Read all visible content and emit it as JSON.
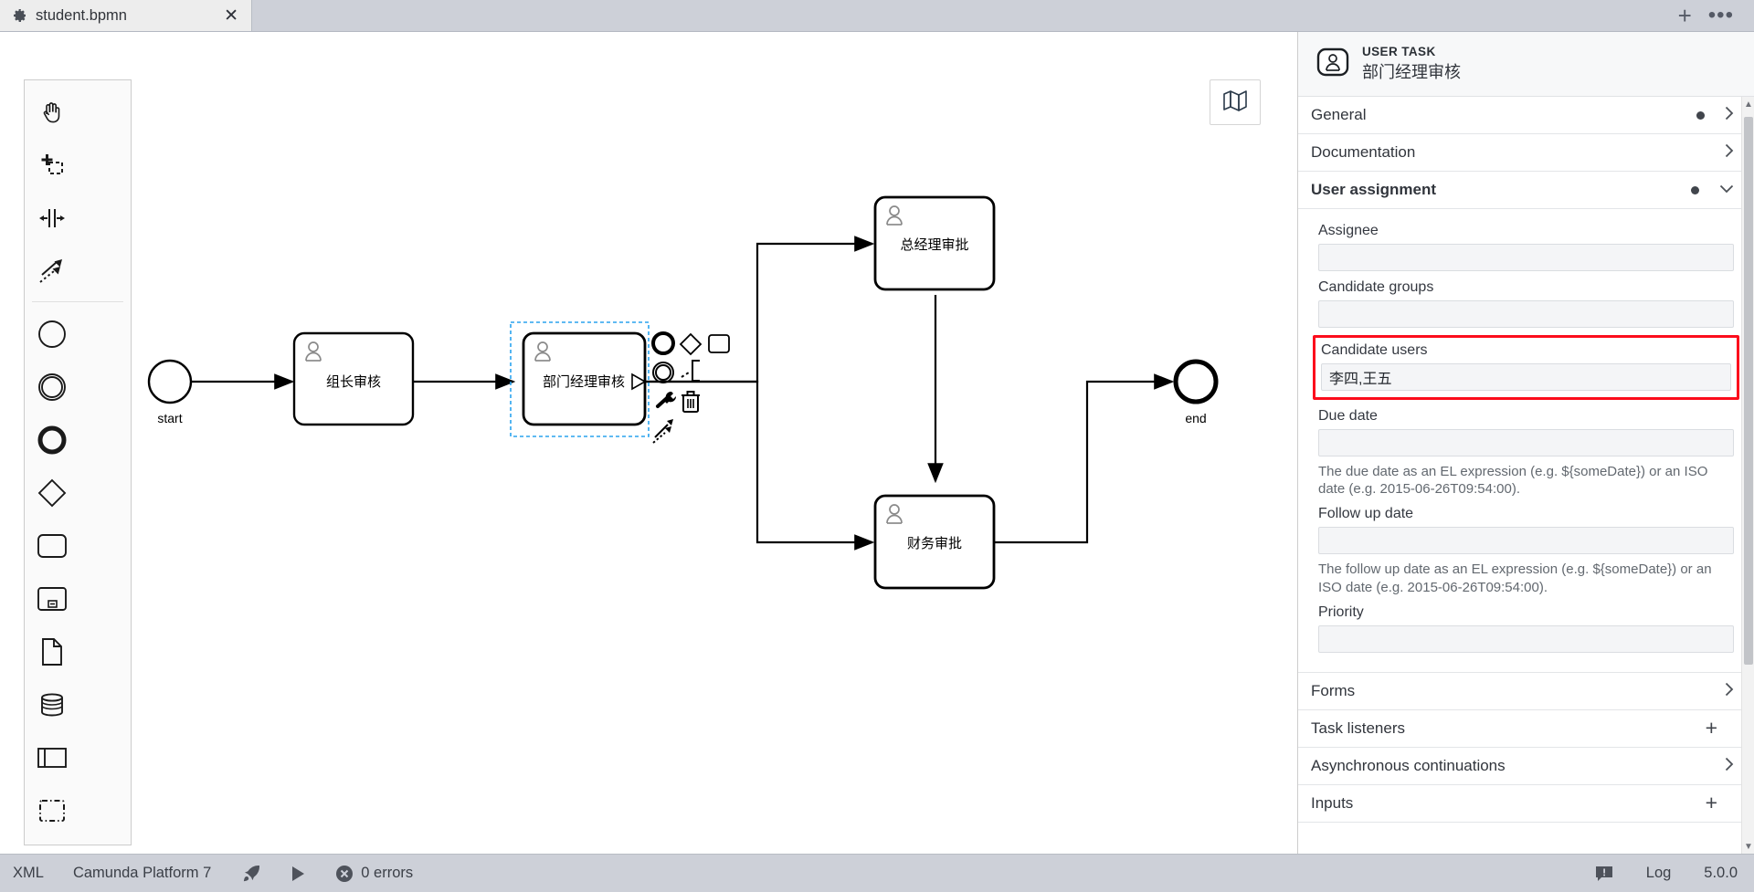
{
  "tabbar": {
    "tab_title": "student.bpmn",
    "tab_icon": "gear-icon",
    "close_label": "✕",
    "add_label": "+",
    "more_label": "•••"
  },
  "palette": {
    "tools": [
      {
        "name": "hand-tool",
        "label": "Activate the hand tool"
      },
      {
        "name": "lasso-tool",
        "label": "Activate the lasso tool"
      },
      {
        "name": "space-tool",
        "label": "Activate the create/remove space tool"
      },
      {
        "name": "connect-tool",
        "label": "Activate the global connect tool"
      },
      {
        "name": "start-event",
        "label": "Create StartEvent"
      },
      {
        "name": "intermediate-event",
        "label": "Create Intermediate/Boundary Event"
      },
      {
        "name": "end-event",
        "label": "Create EndEvent"
      },
      {
        "name": "gateway",
        "label": "Create Gateway"
      },
      {
        "name": "task",
        "label": "Create Task"
      },
      {
        "name": "subprocess-expanded",
        "label": "Create expanded SubProcess"
      },
      {
        "name": "data-object",
        "label": "Create DataObjectReference"
      },
      {
        "name": "data-store",
        "label": "Create DataStoreReference"
      },
      {
        "name": "participant",
        "label": "Create Pool/Participant"
      },
      {
        "name": "group",
        "label": "Create Group"
      }
    ],
    "minimap_label": "map-icon"
  },
  "diagram": {
    "start_event": {
      "label": "start"
    },
    "end_event": {
      "label": "end"
    },
    "tasks": [
      {
        "id": "task1",
        "label": "组长审核",
        "type": "user-task"
      },
      {
        "id": "task2",
        "label": "部门经理审核",
        "type": "user-task",
        "selected": true
      },
      {
        "id": "task3",
        "label": "总经理审批",
        "type": "user-task"
      },
      {
        "id": "task4",
        "label": "财务审批",
        "type": "user-task"
      }
    ],
    "context_pad": [
      {
        "name": "append-end-event-icon"
      },
      {
        "name": "append-gateway-icon"
      },
      {
        "name": "append-task-icon"
      },
      {
        "name": "append-intermediate-event-icon"
      },
      {
        "name": "append-text-annotation-icon"
      },
      {
        "name": "change-type-wrench-icon"
      },
      {
        "name": "delete-trash-icon"
      },
      {
        "name": "connect-arrow-icon"
      }
    ],
    "selection_color": "#2aa3ee"
  },
  "properties": {
    "header": {
      "type": "USER TASK",
      "name": "部门经理审核",
      "icon": "user-task-icon"
    },
    "groups": [
      {
        "id": "general",
        "title": "General",
        "dot": true,
        "control": "chevron-right-icon"
      },
      {
        "id": "documentation",
        "title": "Documentation",
        "dot": false,
        "control": "chevron-right-icon"
      },
      {
        "id": "user_assignment",
        "title": "User assignment",
        "dot": true,
        "control": "chevron-down-icon",
        "open": true
      },
      {
        "id": "forms",
        "title": "Forms",
        "dot": false,
        "control": "chevron-right-icon"
      },
      {
        "id": "task_listeners",
        "title": "Task listeners",
        "dot": false,
        "control": "plus-icon"
      },
      {
        "id": "async_continuations",
        "title": "Asynchronous continuations",
        "dot": false,
        "control": "chevron-right-icon"
      },
      {
        "id": "inputs",
        "title": "Inputs",
        "dot": false,
        "control": "plus-icon"
      }
    ],
    "user_assignment": {
      "assignee": {
        "label": "Assignee",
        "value": "",
        "placeholder": ""
      },
      "candidate_groups": {
        "label": "Candidate groups",
        "value": "",
        "placeholder": ""
      },
      "candidate_users": {
        "label": "Candidate users",
        "value": "李四,王五",
        "placeholder": "",
        "highlight": true,
        "highlight_color": "#fc0d1c"
      },
      "due_date": {
        "label": "Due date",
        "value": "",
        "hint": "The due date as an EL expression (e.g. ${someDate}) or an ISO date (e.g. 2015-06-26T09:54:00)."
      },
      "follow_up_date": {
        "label": "Follow up date",
        "value": "",
        "hint": "The follow up date as an EL expression (e.g. ${someDate}) or an ISO date (e.g. 2015-06-26T09:54:00)."
      },
      "priority": {
        "label": "Priority",
        "value": "",
        "placeholder": ""
      }
    }
  },
  "statusbar": {
    "xml": "XML",
    "platform": "Camunda Platform 7",
    "deploy_icon": "rocket-icon",
    "run_icon": "play-icon",
    "errors": "0 errors",
    "errors_icon": "error-circle-icon",
    "log_icon": "log-icon",
    "log": "Log",
    "version": "5.0.0"
  }
}
